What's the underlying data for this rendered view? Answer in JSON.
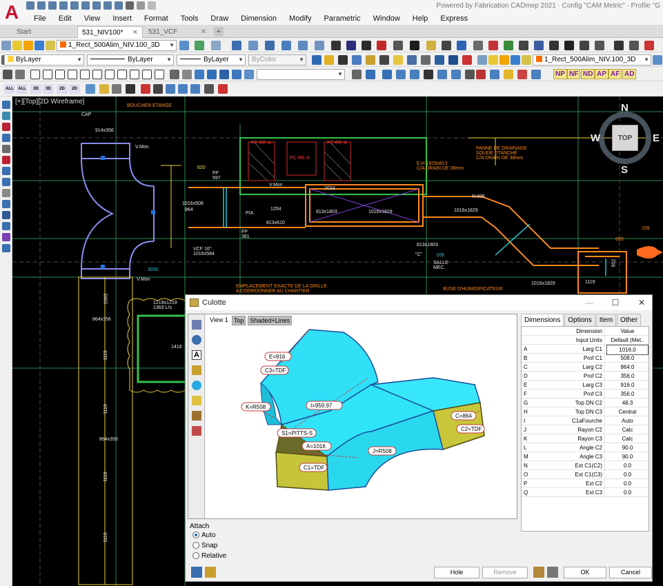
{
  "app": {
    "logo": "A",
    "title": "Powered by Fabrication CADmep 2021 · Config \"CAM Metric\" · Profile \"G"
  },
  "menu": [
    "File",
    "Edit",
    "View",
    "Insert",
    "Format",
    "Tools",
    "Draw",
    "Dimension",
    "Modify",
    "Parametric",
    "Window",
    "Help",
    "Express"
  ],
  "tabs": [
    {
      "label": "Start",
      "active": false
    },
    {
      "label": "531_NIV100*",
      "active": true
    },
    {
      "label": "531_VCF",
      "active": false
    }
  ],
  "toolbars": {
    "layer_combo_1": "1_Rect_500Alim_NIV.100_3D",
    "layer_combo_2": "1_Rect_500Alim_NIV.100_3D",
    "color_combo": "ByLayer",
    "linetype_combo": "ByLayer",
    "lineweight_combo": "ByLayer",
    "plotstyle_combo": "ByColor",
    "empty_combo": "",
    "letter_buttons": [
      "NP",
      "NF",
      "ND",
      "AP",
      "AF",
      "AD"
    ],
    "small_labels": [
      "ALL",
      "ALL",
      "3D",
      "3D",
      "2D",
      "2D"
    ],
    "colors": {
      "accent": "#ffd24a",
      "layer_swatch": "#ff6a00"
    }
  },
  "drawing": {
    "viewport_label": "[+][Top][2D Wireframe]",
    "viewcube": {
      "top": "TOP",
      "n": "N",
      "s": "S",
      "e": "E",
      "w": "W"
    },
    "annotations": {
      "cap": "CAP",
      "cap_size": "914x356",
      "boucher": "BOUCHER ETANGE",
      "v_mon_1": "V.Mon",
      "v_mon_2": "V.Mon",
      "v_mon_3": "V.Mon",
      "dim_620": "620",
      "fp_597": "FP\n597",
      "fp_381": "FP\n381",
      "size_1016x508": "1016x508",
      "size_964": "964",
      "vcf_1016x584": "VCF 16\"\n1016x584",
      "pa": "P/A",
      "size_813x610": "813x610",
      "size_813x1803": "813x1803",
      "size_1016x1829": "1016x1829",
      "eh": "E.H 1829x813\nC/A DRAIN DE 38mm",
      "panne": "PANNE DE DRAINAGE\nSOUDE ETANCHE\nC/A DRAIN DE 38mm",
      "r305": "R:305",
      "grille": "EMPLACEMENT EXACTE DE LA GRILLE\nA COORDONNER AU CHANTIER",
      "buse": "BUSE D'HUMIDIFICATEUR",
      "salle": "SALLE\nMEC.",
      "n109": "109",
      "size_1016x1829b": "1016x1829",
      "size_1016x1829c": "1016x1829",
      "size_1219": "1219x1219\n1363 L/s",
      "n1418": "1418",
      "n1063": "1063",
      "n1119a": "1119",
      "n1119b": "1119",
      "n1119c": "1119",
      "n1119d": "1119",
      "n864a": "864x356",
      "n864b": "864x356",
      "n3030": "3030",
      "n159": "159",
      "n693": "693",
      "n502": "502",
      "n1119e": "1119",
      "pc_label_1": "PC-RE-A",
      "pc_label_2": "PC-RE-A",
      "pc_label_3": "PC-RE-A",
      "n2024": "2024",
      "n1254": "1254",
      "ct": "\"C\"",
      "size_813x1803b": "813x1803"
    }
  },
  "dialog": {
    "title": "Culotte",
    "view_tabs": {
      "view": "View 1",
      "top": "Top",
      "shade": "Shaded+Lines"
    },
    "model_labels": {
      "e": "E=916",
      "c3": "C3=TDF",
      "k": "K=R508",
      "i": "I=959.97",
      "s1": "S1=PITTS-S",
      "a": "A=1016",
      "c1": "C1=TDF",
      "j": "J=R508",
      "c": "C=864",
      "c2": "C2=TDF"
    },
    "attach": {
      "label": "Attach",
      "options": [
        {
          "label": "Auto",
          "checked": true
        },
        {
          "label": "Snap",
          "checked": false
        },
        {
          "label": "Relative",
          "checked": false
        }
      ]
    },
    "right_tabs": [
      "Dimensions",
      "Options",
      "Item",
      "Other"
    ],
    "table_header": {
      "col1": "Dimension",
      "col2": "Value"
    },
    "input_units": {
      "name": "Input Units",
      "value": "Default (Met.."
    },
    "rows": [
      {
        "key": "A",
        "name": "Larg C1",
        "value": "1016.0",
        "selected": true
      },
      {
        "key": "B",
        "name": "Prof C1",
        "value": "508.0"
      },
      {
        "key": "C",
        "name": "Larg C2",
        "value": "864.0"
      },
      {
        "key": "D",
        "name": "Prof C2",
        "value": "356.0"
      },
      {
        "key": "E",
        "name": "Larg C3",
        "value": "916.0"
      },
      {
        "key": "F",
        "name": "Prof C3",
        "value": "356.0"
      },
      {
        "key": "G",
        "name": "Top DN C2",
        "value": "48.3"
      },
      {
        "key": "H",
        "name": "Top DN C3",
        "value": "Central"
      },
      {
        "key": "I",
        "name": "C1aFourche",
        "value": "Auto"
      },
      {
        "key": "J",
        "name": "Rayon C2",
        "value": "Calc"
      },
      {
        "key": "K",
        "name": "Rayon C3",
        "value": "Calc"
      },
      {
        "key": "L",
        "name": "Angle C2",
        "value": "90.0"
      },
      {
        "key": "M",
        "name": "Angle C3",
        "value": "90.0"
      },
      {
        "key": "N",
        "name": "Ext C1(C2)",
        "value": "0.0"
      },
      {
        "key": "O",
        "name": "Ext C1(C3)",
        "value": "0.0"
      },
      {
        "key": "P",
        "name": "Ext C2",
        "value": "0.0"
      },
      {
        "key": "Q",
        "name": "Ext C3",
        "value": "0.0"
      }
    ],
    "buttons": {
      "hole": "Hole",
      "remove": "Remove",
      "ok": "OK",
      "cancel": "Cancel"
    }
  }
}
